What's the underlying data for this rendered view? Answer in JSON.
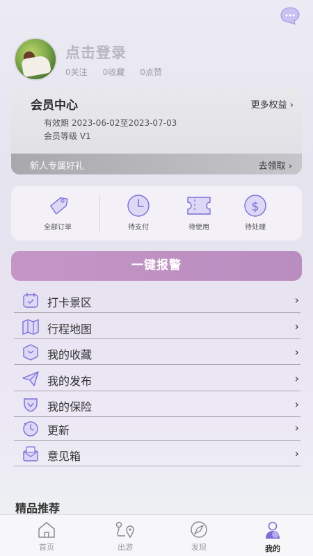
{
  "profile": {
    "login_text": "点击登录",
    "stats": [
      "0关注",
      "0收藏",
      "0点赞"
    ]
  },
  "member": {
    "title": "会员中心",
    "more_label": "更多权益 ›",
    "valid_text": "有效期  2023-06-02至2023-07-03",
    "level_text": "会员等级  V1",
    "gift_text": "新人专属好礼",
    "claim_label": "去领取 ›"
  },
  "orders": [
    {
      "label": "全部订单",
      "icon": "tag-icon"
    },
    {
      "label": "待支付",
      "icon": "clock-icon"
    },
    {
      "label": "待使用",
      "icon": "ticket-icon"
    },
    {
      "label": "待处理",
      "icon": "dollar-icon"
    }
  ],
  "alarm_label": "一键报警",
  "menu": [
    {
      "label": "打卡景区",
      "icon": "checkin-icon"
    },
    {
      "label": "行程地图",
      "icon": "map-icon"
    },
    {
      "label": "我的收藏",
      "icon": "collect-icon"
    },
    {
      "label": "我的发布",
      "icon": "send-icon"
    },
    {
      "label": "我的保险",
      "icon": "shield-icon"
    },
    {
      "label": "更新",
      "icon": "update-icon"
    },
    {
      "label": "意见箱",
      "icon": "mailbox-icon"
    }
  ],
  "chevron": "›",
  "featured_title": "精品推荐",
  "tabs": [
    {
      "label": "首页",
      "icon": "home-icon"
    },
    {
      "label": "出游",
      "icon": "route-icon"
    },
    {
      "label": "发现",
      "icon": "compass-icon"
    },
    {
      "label": "我的",
      "icon": "user-icon"
    }
  ],
  "colors": {
    "accent": "#7b6fd6",
    "alarm_bg": "#c093c3",
    "icon_fill": "#d9d6f5"
  }
}
